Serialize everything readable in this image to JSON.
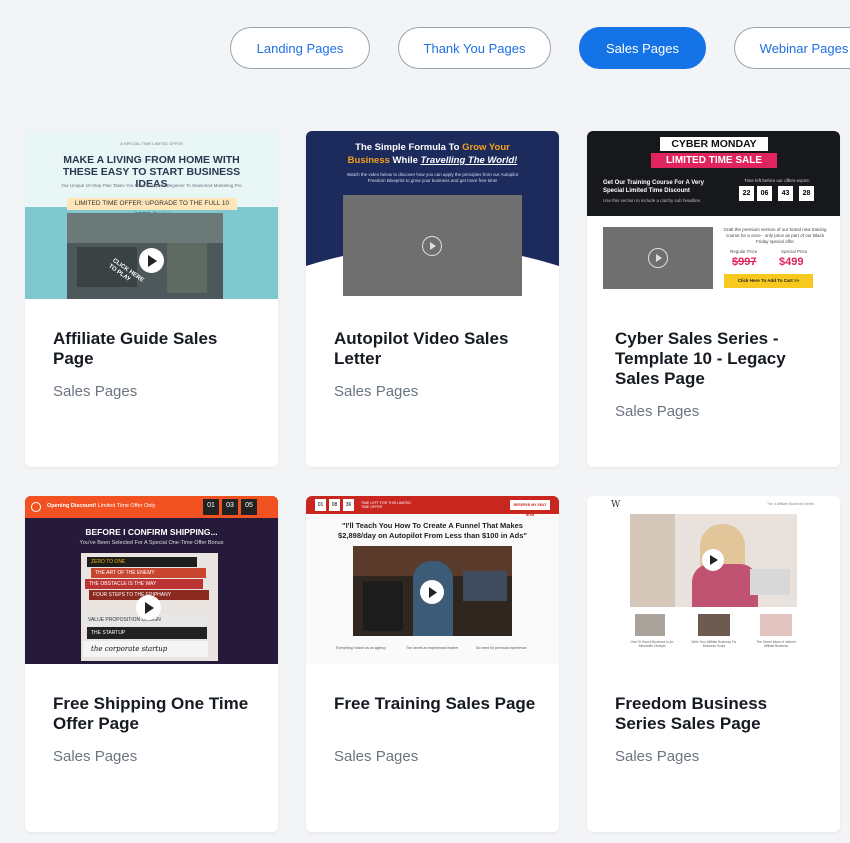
{
  "filters": [
    {
      "label": "Landing Pages",
      "active": false
    },
    {
      "label": "Thank You Pages",
      "active": false
    },
    {
      "label": "Sales Pages",
      "active": true
    },
    {
      "label": "Webinar Pages",
      "active": false
    }
  ],
  "cards": [
    {
      "title": "Affiliate Guide Sales Page",
      "category": "Sales Pages",
      "thumb": {
        "kicker": "A SPECIAL TIME LIMITED OFFER",
        "headline": "MAKE A LIVING FROM HOME WITH THESE EASY TO START BUSINESS IDEAS",
        "sub": "Our Unique 10-Step Plan Takes You From Complete Beginner To Seasoned Marketing Pro",
        "offer": "LIMITED TIME OFFER: UPGRADE TO THE FULL 10 STEP PLAN",
        "click": "CLICK HERE TO PLAY"
      }
    },
    {
      "title": "Autopilot Video Sales Letter",
      "category": "Sales Pages",
      "thumb": {
        "headline_a": "The Simple Formula To ",
        "headline_b": "Grow Your",
        "headline_c": "Business",
        "headline_d": " While ",
        "headline_e": "Travelling The World!",
        "sub": "Watch the video below to discover how you can apply the principles from our Autopilot Freedom Blueprint to grow your business and get more free time!"
      }
    },
    {
      "title": "Cyber Sales Series - Template 10 - Legacy Sales Page",
      "category": "Sales Pages",
      "thumb": {
        "banner": "CYBER MONDAY",
        "ribbon": "LIMITED TIME SALE",
        "offer": "Get Our Training Course For A Very Special Limited Time Discount",
        "offer_sub": "Use this section to include a catchy sub headline.",
        "timer_label": "Time left before our offers expire:",
        "timer": [
          "22",
          "06",
          "43",
          "28"
        ],
        "desc": "Grab the premium version of our brand new training course for a once - only price as part of our Black Friday special offer",
        "regular_label": "Regular Price",
        "regular_price": "$997",
        "special_label": "Special Price",
        "special_price": "$499",
        "cta": "Click Here To Add To Cart >>"
      }
    },
    {
      "title": "Free Shipping One Time Offer Page",
      "category": "Sales Pages",
      "thumb": {
        "bar_a": "Opening Discount!",
        "bar_b": " Limited Time Offer Only",
        "timer": [
          "01",
          "03",
          "05"
        ],
        "headline": "BEFORE I CONFIRM SHIPPING...",
        "sub": "You've Been Selected For A Special One-Time Offer Bonus",
        "books": [
          "ZERO TO ONE",
          "THE ART OF THE ENEMY",
          "THE OBSTACLE IS THE WAY",
          "FOUR STEPS TO THE EPIPHANY",
          "VALUE PROPOSITION DESIGN",
          "THE STARTUP",
          "the corporate startup"
        ]
      }
    },
    {
      "title": "Free Training Sales Page",
      "category": "Sales Pages",
      "thumb": {
        "timer": [
          "01",
          "08",
          "36"
        ],
        "bar_text": "TIME LEFT FOR THIS LIMITED TIME OFFER",
        "bar_button": "RESERVE MY SEAT NOW",
        "headline": "\"I'll Teach You How To Create A Funnel That Makes $2,898/day on Autopilot From Less than $100 in Ads\"",
        "bullets": [
          "Everything I learnt as an agency",
          "The secret an experienced trainer",
          "No need for previous experience"
        ]
      }
    },
    {
      "title": "Freedom Business Series Sales Page",
      "category": "Sales Pages",
      "thumb": {
        "logo": "W",
        "nav": "The 4 Affiliate Business Series",
        "captions": [
          "How To Start A Business In An Affordable Lifestyle",
          "Write Your Affiliate Business For Business Hours",
          "The Secret Ideas of Internet Affiliate Business"
        ]
      }
    }
  ]
}
